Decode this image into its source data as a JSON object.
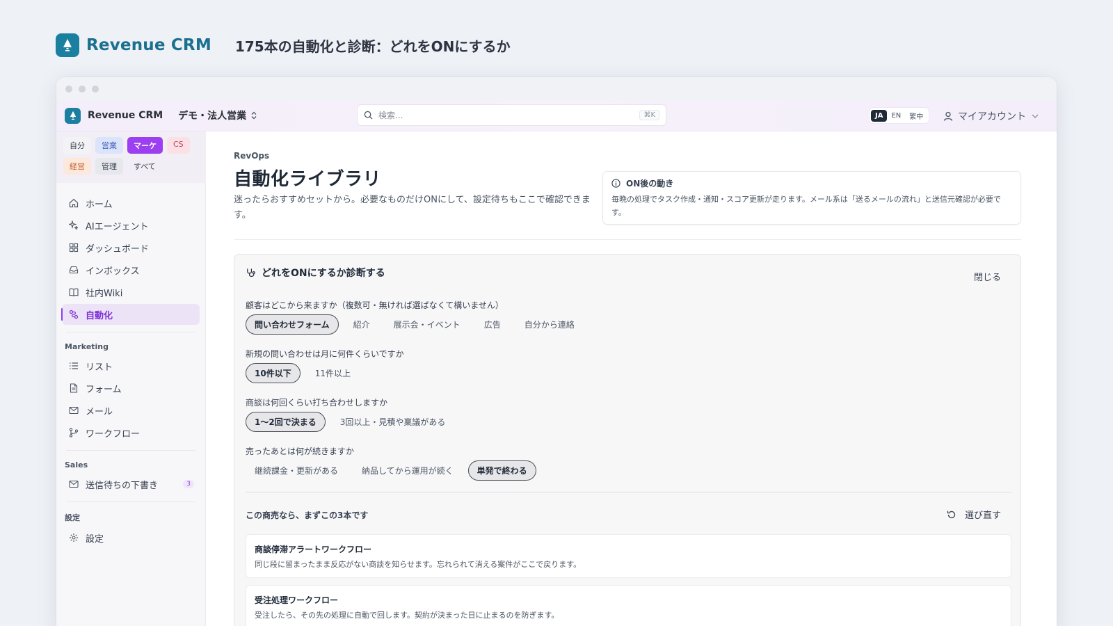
{
  "page": {
    "brand": "Revenue CRM",
    "headline": "175本の自動化と診断：どれをONにするか"
  },
  "topbar": {
    "app_name": "Revenue CRM",
    "workspace": "デモ・法人営業",
    "search_placeholder": "検索...",
    "search_shortcut": "⌘K",
    "languages": [
      "JA",
      "EN",
      "繁中"
    ],
    "active_language": "JA",
    "account": "マイアカウント"
  },
  "sidebar": {
    "roles": [
      "自分",
      "営業",
      "マーケ",
      "CS",
      "経営",
      "管理",
      "すべて"
    ],
    "active_role": "マーケ",
    "main_nav": [
      {
        "label": "ホーム",
        "icon": "home-icon"
      },
      {
        "label": "AIエージェント",
        "icon": "sparkles-icon"
      },
      {
        "label": "ダッシュボード",
        "icon": "dashboard-icon"
      },
      {
        "label": "インボックス",
        "icon": "inbox-icon"
      },
      {
        "label": "社内Wiki",
        "icon": "book-icon"
      },
      {
        "label": "自動化",
        "icon": "automation-icon",
        "active": true
      }
    ],
    "marketing_section": "Marketing",
    "marketing_nav": [
      {
        "label": "リスト",
        "icon": "list-icon"
      },
      {
        "label": "フォーム",
        "icon": "form-icon"
      },
      {
        "label": "メール",
        "icon": "mail-icon"
      },
      {
        "label": "ワークフロー",
        "icon": "workflow-icon"
      }
    ],
    "sales_section": "Sales",
    "sales_nav": [
      {
        "label": "送信待ちの下書き",
        "icon": "mail-icon",
        "badge": "3"
      }
    ],
    "settings_section": "設定",
    "settings_nav": [
      {
        "label": "設定",
        "icon": "gear-icon"
      }
    ]
  },
  "main": {
    "breadcrumb": "RevOps",
    "title": "自動化ライブラリ",
    "description": "迷ったらおすすめセットから。必要なものだけONにして、設定待ちもここで確認できます。",
    "info": {
      "title": "ON後の動き",
      "body": "毎晩の処理でタスク作成・通知・スコア更新が走ります。メール系は「送るメールの流れ」と送信元確認が必要です。"
    },
    "diagnosis": {
      "title": "どれをONにするか診断する",
      "close_label": "閉じる",
      "questions": [
        {
          "label": "顧客はどこから来ますか（複数可・無ければ選ばなくて構いません）",
          "options": [
            "問い合わせフォーム",
            "紹介",
            "展示会・イベント",
            "広告",
            "自分から連絡"
          ],
          "selected": [
            0
          ]
        },
        {
          "label": "新規の問い合わせは月に何件くらいですか",
          "options": [
            "10件以下",
            "11件以上"
          ],
          "selected": [
            0
          ]
        },
        {
          "label": "商談は何回くらい打ち合わせしますか",
          "options": [
            "1〜2回で決まる",
            "3回以上・見積や稟議がある"
          ],
          "selected": [
            0
          ]
        },
        {
          "label": "売ったあとは何が続きますか",
          "options": [
            "継続課金・更新がある",
            "納品してから運用が続く",
            "単発で終わる"
          ],
          "selected": [
            2
          ]
        }
      ],
      "recommend_title": "この商売なら、まずこの3本です",
      "reselect_label": "選び直す",
      "recommendations": [
        {
          "name": "商談停滞アラートワークフロー",
          "desc": "同じ段に留まったまま反応がない商談を知らせます。忘れられて消える案件がここで戻ります。"
        },
        {
          "name": "受注処理ワークフロー",
          "desc": "受注したら、その先の処理に自動で回します。契約が決まった日に止まるのを防ぎます。"
        }
      ]
    }
  },
  "colors": {
    "brand": "#1b7fa0",
    "accent": "#8b3fe6"
  }
}
